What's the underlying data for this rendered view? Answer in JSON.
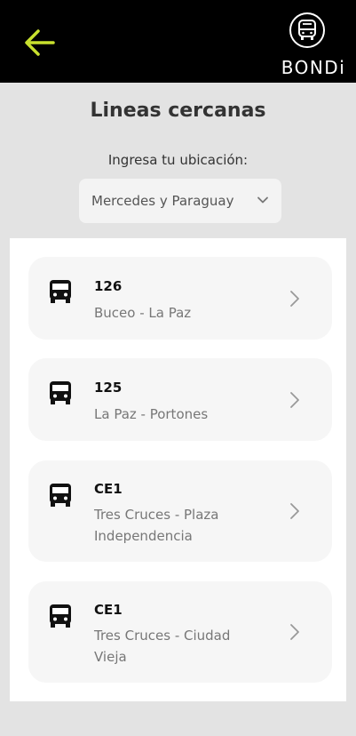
{
  "header": {
    "logo_text": "BONDi",
    "accent_color": "#c8e02e",
    "back_icon": "arrow-left-icon",
    "logo_icon": "bus-icon"
  },
  "page": {
    "title": "Lineas cercanas",
    "location_label": "Ingresa tu ubicación:",
    "location_value": "Mercedes y Paraguay"
  },
  "lines": [
    {
      "code": "126",
      "route": "Buceo - La Paz"
    },
    {
      "code": "125",
      "route": "La Paz - Portones"
    },
    {
      "code": "CE1",
      "route": "Tres Cruces - Plaza Independencia"
    },
    {
      "code": "CE1",
      "route": "Tres Cruces - Ciudad Vieja"
    }
  ]
}
